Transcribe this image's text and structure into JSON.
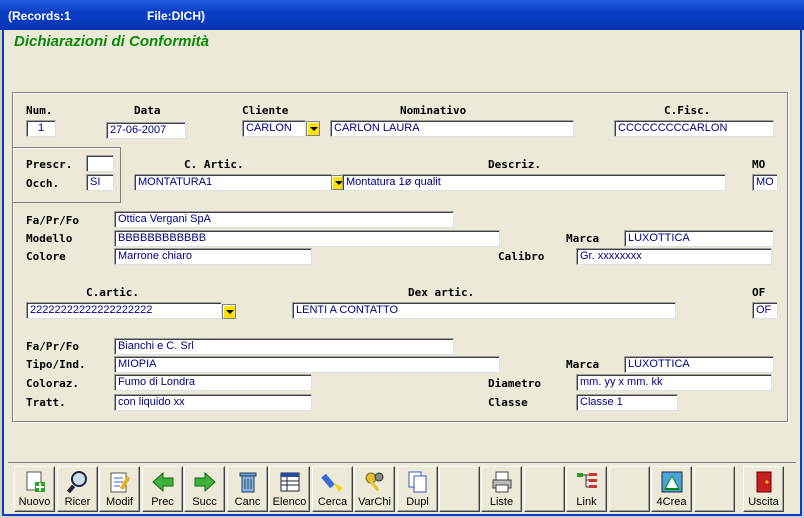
{
  "titlebar": {
    "records": "(Records:1",
    "file": "File:DICH)"
  },
  "page_title": "Dichiarazioni di Conformità",
  "header": {
    "num_label": "Num.",
    "num_value": "1",
    "data_label": "Data",
    "data_value": "27-06-2007",
    "cliente_label": "Cliente",
    "cliente_value": "CARLON",
    "nominativo_label": "Nominativo",
    "nominativo_value": "CARLON LAURA",
    "cfisc_label": "C.Fisc.",
    "cfisc_value": "CCCCCCCCCARLON"
  },
  "prescr": {
    "prescr_label": "Prescr.",
    "prescr_value": "",
    "occh_label": "Occh.",
    "occh_value": "SI"
  },
  "article1": {
    "carti_label": "C. Artic.",
    "carti_value": "MONTATURA1",
    "descr_label": "Descriz.",
    "descr_value": "Montatura 1ø qualit",
    "mo_label": "MO",
    "mo_value": "MO",
    "fa_label": "Fa/Pr/Fo",
    "fa_value": "Ottica Vergani SpA",
    "modello_label": "Modello",
    "modello_value": "BBBBBBBBBBBB",
    "marca_label": "Marca",
    "marca_value": "LUXOTTICA",
    "colore_label": "Colore",
    "colore_value": "Marrone chiaro",
    "calibro_label": "Calibro",
    "calibro_value": "Gr. xxxxxxxx"
  },
  "article2": {
    "carti_label": "C.artic.",
    "carti_value": "22222222222222222222",
    "dex_label": "Dex artic.",
    "dex_value": "LENTI A CONTATTO",
    "of_label": "OF",
    "of_value": "OF",
    "fa_label": "Fa/Pr/Fo",
    "fa_value": "Bianchi e C. Srl",
    "tipo_label": "Tipo/Ind.",
    "tipo_value": "MIOPIA",
    "marca_label": "Marca",
    "marca_value": "LUXOTTICA",
    "coloraz_label": "Coloraz.",
    "coloraz_value": "Fumo di Londra",
    "diametro_label": "Diametro",
    "diametro_value": "mm. yy  x  mm. kk",
    "tratt_label": "Tratt.",
    "tratt_value": "con liquido xx",
    "classe_label": "Classe",
    "classe_value": "Classe 1"
  },
  "toolbar": {
    "nuovo": "Nuovo",
    "ricer": "Ricer",
    "modif": "Modif",
    "prec": "Prec",
    "succ": "Succ",
    "canc": "Canc",
    "elenco": "Elenco",
    "cerca": "Cerca",
    "varchi": "VarChi",
    "dupl": "Dupl",
    "liste": "Liste",
    "link": "Link",
    "crea": "4Crea",
    "uscita": "Uscita"
  }
}
